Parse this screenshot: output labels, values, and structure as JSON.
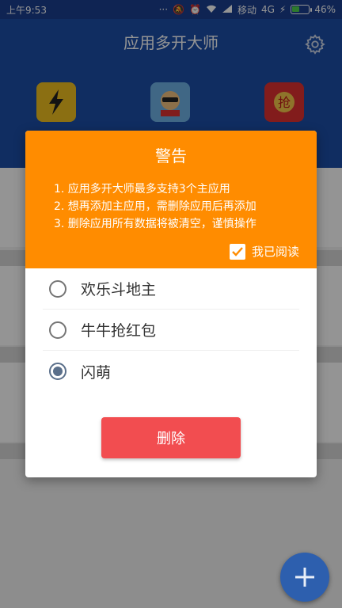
{
  "status_bar": {
    "time": "上午9:53",
    "carrier": "移动",
    "network": "4G",
    "battery_percent": "46%",
    "battery_level": 0.46,
    "icons": [
      "signal-dots-icon",
      "mute-icon",
      "alarm-icon",
      "wifi-icon",
      "cell-signal-icon",
      "charging-icon",
      "battery-icon"
    ]
  },
  "app_bar": {
    "title": "应用多开大师",
    "settings_icon": "gear-icon",
    "apps": [
      {
        "icon": "lightning-app-icon",
        "color": "#f0c020"
      },
      {
        "icon": "cartoon-character-app-icon",
        "color": "#6fb2e6"
      },
      {
        "icon": "red-envelope-app-icon",
        "color": "#e03131",
        "glyph": "抢"
      }
    ]
  },
  "dialog": {
    "title": "警告",
    "rules": [
      "1. 应用多开大师最多支持3个主应用",
      "2. 想再添加主应用，需删除应用后再添加",
      "3. 删除应用所有数据将被清空，谨慎操作"
    ],
    "read_label": "我已阅读",
    "read_checked": true,
    "options": [
      {
        "label": "欢乐斗地主",
        "selected": false
      },
      {
        "label": "牛牛抢红包",
        "selected": false
      },
      {
        "label": "闪萌",
        "selected": true
      }
    ],
    "delete_label": "删除"
  },
  "fab": {
    "icon": "plus-icon"
  },
  "colors": {
    "primary": "#1c4fa8",
    "warning": "#ff8c00",
    "danger": "#f24d50"
  }
}
